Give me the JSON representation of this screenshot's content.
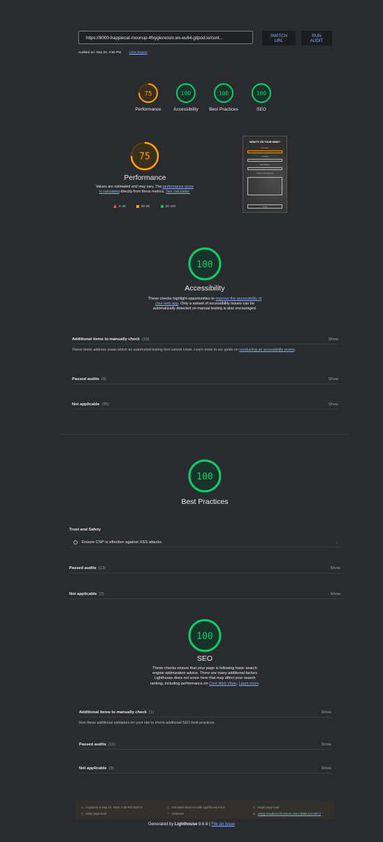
{
  "topbar": {
    "url": "https://8000-frappiecat-moonup-4fxygkvxosm.ws-eu64.gitpod.io/cont...",
    "switch_url": "SWITCH\nURL",
    "run_audit": "RUN\nAUDIT",
    "audited_on": "Audited on: Sep 22, 4:56 PM",
    "view_report": "View Report"
  },
  "colors": {
    "orange": "#ffa400",
    "green": "#0cce6b",
    "red": "#ff4e42",
    "link": "#8ab4f8",
    "background": "#2a2b2e"
  },
  "gauges": [
    {
      "label": "Performance",
      "score": 75,
      "color": "#ffa400"
    },
    {
      "label": "Accessibility",
      "score": 100,
      "color": "#0cce6b"
    },
    {
      "label": "Best Practices",
      "score": 100,
      "color": "#0cce6b"
    },
    {
      "label": "SEO",
      "score": 100,
      "color": "#0cce6b"
    }
  ],
  "performance": {
    "score": 75,
    "title": "Performance",
    "desc_1": "Values are estimated and may vary. The ",
    "desc_link_1": "performance score is calculated",
    "desc_2": " directly from these metrics. ",
    "desc_link_2": "See calculator.",
    "legend": [
      {
        "range": "0–49",
        "color": "#ff4e42",
        "shape": "triangle"
      },
      {
        "range": "50–89",
        "color": "#ffa400",
        "shape": "square"
      },
      {
        "range": "90–100",
        "color": "#0cce6b",
        "shape": "circle"
      }
    ],
    "screenshot": {
      "heading": "WHAT'S ON YOUR MIND?",
      "field_1": "First Name",
      "field_2": "Last Name",
      "field_3": "Email Address",
      "field_4": "Type your message here",
      "submit": "Submit"
    }
  },
  "accessibility": {
    "score": 100,
    "title": "Accessibility",
    "desc_1": "These checks highlight opportunities to ",
    "desc_link": "improve the accessibility of your web app",
    "desc_2": ". Only a subset of accessibility issues can be automatically detected so manual testing is also encouraged.",
    "manual": {
      "title": "Additional items to manually check",
      "count": "(10)",
      "show": "Show"
    },
    "manual_desc_1": "These items address areas which an automated testing tool cannot cover. Learn more in our guide on ",
    "manual_desc_link": "conducting an accessibility review",
    "manual_desc_2": ".",
    "passed": {
      "title": "Passed audits",
      "count": "(9)",
      "show": "Show"
    },
    "not_applicable": {
      "title": "Not applicable",
      "count": "(35)",
      "show": "Show"
    }
  },
  "best_practices": {
    "score": 100,
    "title": "Best Practices",
    "trust_heading": "Trust and Safety",
    "trust_item": "Ensure CSP is effective against XSS attacks",
    "passed": {
      "title": "Passed audits",
      "count": "(13)",
      "show": "Show"
    },
    "not_applicable": {
      "title": "Not applicable",
      "count": "(2)",
      "show": "Show"
    }
  },
  "seo": {
    "score": 100,
    "title": "SEO",
    "desc_1": "These checks ensure that your page is following basic search engine optimization advice. There are many additional factors Lighthouse does not score here that may affect your search ranking, including performance on ",
    "desc_link_1": "Core Web Vitals",
    "desc_2": ". ",
    "desc_link_2": "Learn more",
    "desc_3": ".",
    "manual": {
      "title": "Additional items to manually check",
      "count": "(1)",
      "show": "Show"
    },
    "manual_desc": "Run these additional validators on your site to check additional SEO best practices.",
    "passed": {
      "title": "Passed audits",
      "count": "(11)",
      "show": "Show"
    },
    "not_applicable": {
      "title": "Not applicable",
      "count": "(3)",
      "show": "Show"
    }
  },
  "footer": {
    "captured": "Captured at Sep 22, 2022, 4:56 PM GMT+1",
    "initial_load": "Initial page load",
    "emulated": "Emulated Moto G4 with Lighthouse 9.6.6",
    "unknown": "Unknown",
    "single_load": "Single page load",
    "using": "Using HeadlessChromium 103.0.5060.114 with lr",
    "generated_prefix": "Generated by ",
    "generated_name": "Lighthouse",
    "generated_version": " 9.6.6 | ",
    "file_issue": "File an issue"
  }
}
